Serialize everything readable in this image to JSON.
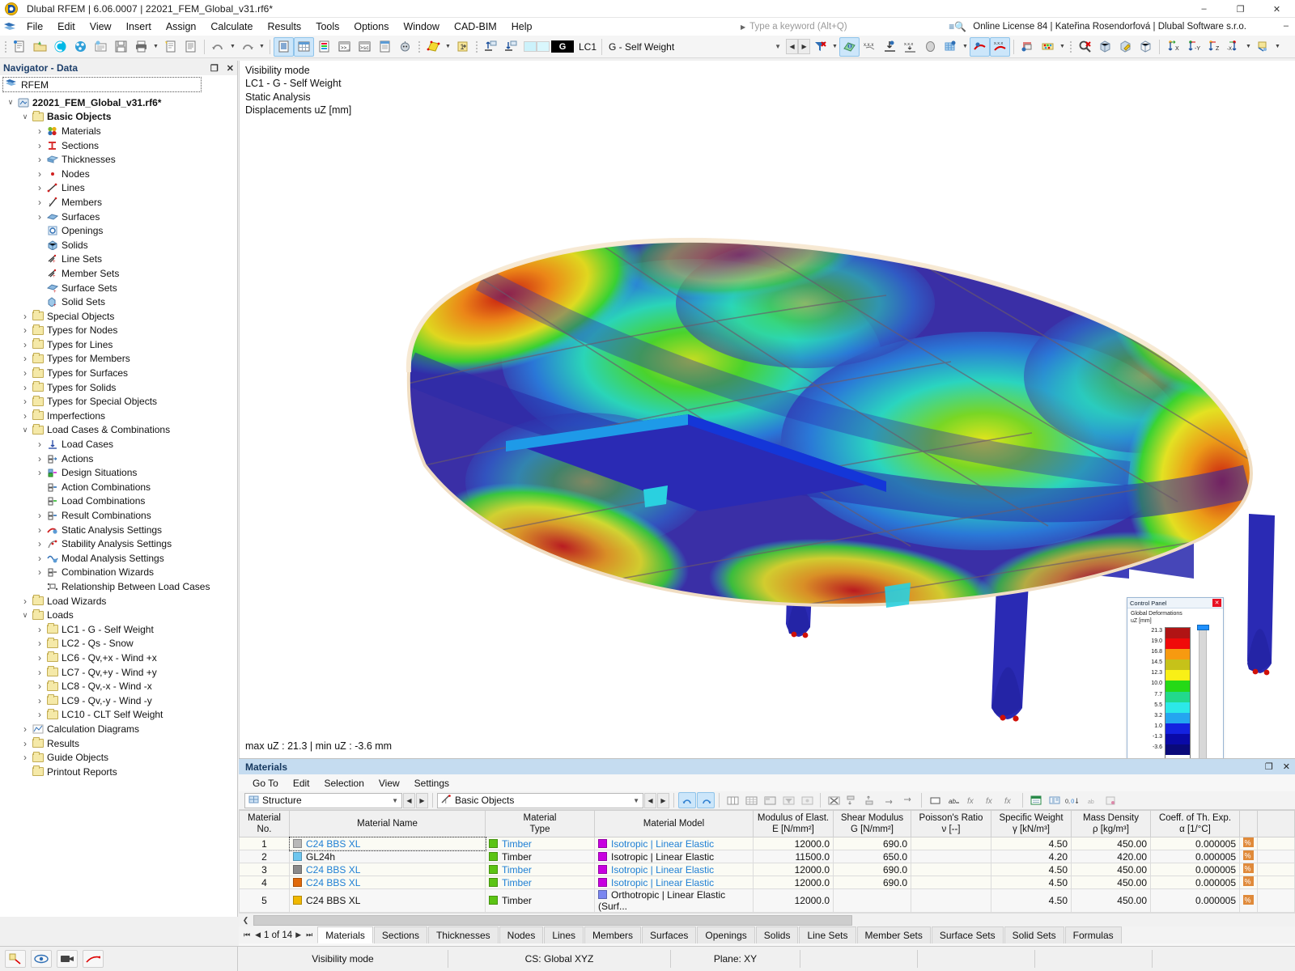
{
  "window": {
    "title": "Dlubal RFEM | 6.06.0007 | 22021_FEM_Global_v31.rf6*",
    "minimize": "–",
    "maximize": "❐",
    "close": "✕"
  },
  "menubar": {
    "items": [
      "File",
      "Edit",
      "View",
      "Insert",
      "Assign",
      "Calculate",
      "Results",
      "Tools",
      "Options",
      "Window",
      "CAD-BIM",
      "Help"
    ],
    "keyword_search_placeholder": "Type a keyword (Alt+Q)",
    "license": "Online License 84 | Kateřina Rosendorfová | Dlubal Software s.r.o.",
    "minimize": "–"
  },
  "toolbar": {
    "load_case_letter": "G",
    "load_case_id": "LC1",
    "load_case_name": "G - Self Weight",
    "icons": [
      "new-model-icon",
      "open-icon",
      "cloud-icon",
      "network-icon",
      "model-info-icon",
      "save-icon",
      "print-icon",
      "print-preview-icon",
      "printout-report-icon",
      "undo-icon",
      "redo-icon",
      "navigator-icon",
      "table-icon",
      "colors-icon",
      "console-icon",
      "script-icon",
      "data-icon",
      "help-robot-icon",
      "render-icon",
      "numbering-icon",
      "surface-result-icon",
      "deformation-icon",
      "filter-icon",
      "results-on-surfaces-icon",
      "values-icon",
      "result-diagram-icon",
      "search-delete-icon",
      "solid-view-icon",
      "edit-view-icon",
      "wireframe-icon",
      "axis-x-icon",
      "axis-y-icon",
      "axis-z-icon",
      "axis-negx-icon",
      "perspective-icon"
    ]
  },
  "navigator": {
    "title": "Navigator - Data",
    "undock": "❐",
    "close": "✕",
    "root_combo": "RFEM",
    "tree": [
      {
        "depth": 0,
        "twist": "open",
        "icon": "model-icon",
        "label": "22021_FEM_Global_v31.rf6*",
        "bold": true
      },
      {
        "depth": 1,
        "twist": "open",
        "icon": "folder",
        "label": "Basic Objects",
        "bold": true
      },
      {
        "depth": 2,
        "twist": "closed",
        "icon": "materials-icon",
        "label": "Materials"
      },
      {
        "depth": 2,
        "twist": "closed",
        "icon": "sections-icon",
        "label": "Sections"
      },
      {
        "depth": 2,
        "twist": "closed",
        "icon": "thicknesses-icon",
        "label": "Thicknesses"
      },
      {
        "depth": 2,
        "twist": "closed",
        "icon": "nodes-icon",
        "label": "Nodes"
      },
      {
        "depth": 2,
        "twist": "closed",
        "icon": "lines-icon",
        "label": "Lines"
      },
      {
        "depth": 2,
        "twist": "closed",
        "icon": "members-icon",
        "label": "Members"
      },
      {
        "depth": 2,
        "twist": "closed",
        "icon": "surfaces-icon",
        "label": "Surfaces"
      },
      {
        "depth": 2,
        "twist": "none",
        "icon": "openings-icon",
        "label": "Openings"
      },
      {
        "depth": 2,
        "twist": "none",
        "icon": "solids-icon",
        "label": "Solids"
      },
      {
        "depth": 2,
        "twist": "none",
        "icon": "line-sets-icon",
        "label": "Line Sets"
      },
      {
        "depth": 2,
        "twist": "none",
        "icon": "member-sets-icon",
        "label": "Member Sets"
      },
      {
        "depth": 2,
        "twist": "none",
        "icon": "surface-sets-icon",
        "label": "Surface Sets"
      },
      {
        "depth": 2,
        "twist": "none",
        "icon": "solid-sets-icon",
        "label": "Solid Sets"
      },
      {
        "depth": 1,
        "twist": "closed",
        "icon": "folder",
        "label": "Special Objects"
      },
      {
        "depth": 1,
        "twist": "closed",
        "icon": "folder",
        "label": "Types for Nodes"
      },
      {
        "depth": 1,
        "twist": "closed",
        "icon": "folder",
        "label": "Types for Lines"
      },
      {
        "depth": 1,
        "twist": "closed",
        "icon": "folder",
        "label": "Types for Members"
      },
      {
        "depth": 1,
        "twist": "closed",
        "icon": "folder",
        "label": "Types for Surfaces"
      },
      {
        "depth": 1,
        "twist": "closed",
        "icon": "folder",
        "label": "Types for Solids"
      },
      {
        "depth": 1,
        "twist": "closed",
        "icon": "folder",
        "label": "Types for Special Objects"
      },
      {
        "depth": 1,
        "twist": "closed",
        "icon": "folder",
        "label": "Imperfections"
      },
      {
        "depth": 1,
        "twist": "open",
        "icon": "folder",
        "label": "Load Cases & Combinations"
      },
      {
        "depth": 2,
        "twist": "closed",
        "icon": "load-cases-icon",
        "label": "Load Cases"
      },
      {
        "depth": 2,
        "twist": "closed",
        "icon": "actions-icon",
        "label": "Actions"
      },
      {
        "depth": 2,
        "twist": "closed",
        "icon": "design-situations-icon",
        "label": "Design Situations"
      },
      {
        "depth": 2,
        "twist": "none",
        "icon": "action-combinations-icon",
        "label": "Action Combinations"
      },
      {
        "depth": 2,
        "twist": "none",
        "icon": "load-combinations-icon",
        "label": "Load Combinations"
      },
      {
        "depth": 2,
        "twist": "closed",
        "icon": "result-combinations-icon",
        "label": "Result Combinations"
      },
      {
        "depth": 2,
        "twist": "closed",
        "icon": "static-analysis-icon",
        "label": "Static Analysis Settings"
      },
      {
        "depth": 2,
        "twist": "closed",
        "icon": "stability-analysis-icon",
        "label": "Stability Analysis Settings"
      },
      {
        "depth": 2,
        "twist": "closed",
        "icon": "modal-analysis-icon",
        "label": "Modal Analysis Settings"
      },
      {
        "depth": 2,
        "twist": "closed",
        "icon": "combination-wizards-icon",
        "label": "Combination Wizards"
      },
      {
        "depth": 2,
        "twist": "none",
        "icon": "relationship-icon",
        "label": "Relationship Between Load Cases"
      },
      {
        "depth": 1,
        "twist": "closed",
        "icon": "folder",
        "label": "Load Wizards"
      },
      {
        "depth": 1,
        "twist": "open",
        "icon": "folder",
        "label": "Loads"
      },
      {
        "depth": 2,
        "twist": "closed",
        "icon": "folder",
        "label": "LC1 - G - Self Weight"
      },
      {
        "depth": 2,
        "twist": "closed",
        "icon": "folder",
        "label": "LC2 - Qs - Snow"
      },
      {
        "depth": 2,
        "twist": "closed",
        "icon": "folder",
        "label": "LC6 - Qv,+x - Wind +x"
      },
      {
        "depth": 2,
        "twist": "closed",
        "icon": "folder",
        "label": "LC7 - Qv,+y - Wind +y"
      },
      {
        "depth": 2,
        "twist": "closed",
        "icon": "folder",
        "label": "LC8 - Qv,-x - Wind -x"
      },
      {
        "depth": 2,
        "twist": "closed",
        "icon": "folder",
        "label": "LC9 - Qv,-y - Wind -y"
      },
      {
        "depth": 2,
        "twist": "closed",
        "icon": "folder",
        "label": "LC10 - CLT Self Weight"
      },
      {
        "depth": 1,
        "twist": "closed",
        "icon": "calculation-diagrams-icon",
        "label": "Calculation Diagrams"
      },
      {
        "depth": 1,
        "twist": "closed",
        "icon": "folder",
        "label": "Results"
      },
      {
        "depth": 1,
        "twist": "closed",
        "icon": "folder",
        "label": "Guide Objects"
      },
      {
        "depth": 1,
        "twist": "none",
        "icon": "folder",
        "label": "Printout Reports"
      }
    ]
  },
  "viewport": {
    "info_lines": [
      "Visibility mode",
      "LC1 - G - Self Weight",
      "Static Analysis",
      "Displacements uZ [mm]"
    ],
    "max_min": "max uZ : 21.3 | min uZ : -3.6 mm"
  },
  "control_panel": {
    "title": "Control Panel",
    "close": "✕",
    "subtitle_line1": "Global Deformations",
    "subtitle_line2": "uZ [mm]",
    "scale_values": [
      "21.3",
      "19.0",
      "16.8",
      "14.5",
      "12.3",
      "10.0",
      "7.7",
      "5.5",
      "3.2",
      "1.0",
      "-1.3",
      "-3.6"
    ],
    "scale_colors": [
      "#b01414",
      "#f00a0a",
      "#f79a10",
      "#c6c219",
      "#f9f016",
      "#25d916",
      "#22d98c",
      "#2ce8e8",
      "#24a5f0",
      "#1422e0",
      "#0a0aa8",
      "#0a0a7a"
    ]
  },
  "chart_data": {
    "type": "heatmap",
    "title": "Global Deformations uZ [mm]",
    "legend_position": "right",
    "colorbar_label": "uZ [mm]",
    "ticks": [
      21.3,
      19.0,
      16.8,
      14.5,
      12.3,
      10.0,
      7.7,
      5.5,
      3.2,
      1.0,
      -1.3,
      -3.6
    ],
    "colors": [
      "#b01414",
      "#f00a0a",
      "#f79a10",
      "#c6c219",
      "#f9f016",
      "#25d916",
      "#22d98c",
      "#2ce8e8",
      "#24a5f0",
      "#1422e0",
      "#0a0aa8",
      "#0a0a7a"
    ],
    "zlim": [
      -3.6,
      21.3
    ],
    "max_value": 21.3,
    "min_value": -3.6,
    "units": "mm",
    "load_case": "LC1 - G - Self Weight",
    "analysis": "Static Analysis"
  },
  "materials_panel": {
    "title": "Materials",
    "undock": "❐",
    "close": "✕",
    "menu": [
      "Go To",
      "Edit",
      "Selection",
      "View",
      "Settings"
    ],
    "filter_left": "Structure",
    "filter_right": "Basic Objects",
    "columns": [
      {
        "line1": "Material",
        "line2": "No."
      },
      {
        "line1": "",
        "line2": "Material Name"
      },
      {
        "line1": "Material",
        "line2": "Type"
      },
      {
        "line1": "",
        "line2": "Material Model"
      },
      {
        "line1": "Modulus of Elast.",
        "line2": "E [N/mm²]"
      },
      {
        "line1": "Shear Modulus",
        "line2": "G [N/mm²]"
      },
      {
        "line1": "Poisson's Ratio",
        "line2": "ν [--]"
      },
      {
        "line1": "Specific Weight",
        "line2": "γ [kN/m³]"
      },
      {
        "line1": "Mass Density",
        "line2": "ρ [kg/m³]"
      },
      {
        "line1": "Coeff. of Th. Exp.",
        "line2": "α [1/°C]"
      }
    ],
    "rows": [
      {
        "no": "1",
        "color": "#b8b8b8",
        "name": "C24 BBS XL",
        "type": "Timber",
        "model": "Isotropic | Linear Elastic",
        "model_color": "#c800e0",
        "E": "12000.0",
        "G": "690.0",
        "nu": "",
        "gamma": "4.50",
        "rho": "450.00",
        "alpha": "0.000005",
        "blue": true,
        "selected": true
      },
      {
        "no": "2",
        "color": "#6ec6ef",
        "name": "GL24h",
        "type": "Timber",
        "model": "Isotropic | Linear Elastic",
        "model_color": "#c800e0",
        "E": "11500.0",
        "G": "650.0",
        "nu": "",
        "gamma": "4.20",
        "rho": "420.00",
        "alpha": "0.000005",
        "blue": false,
        "selected": false
      },
      {
        "no": "3",
        "color": "#8a8a8a",
        "name": "C24 BBS XL",
        "type": "Timber",
        "model": "Isotropic | Linear Elastic",
        "model_color": "#c800e0",
        "E": "12000.0",
        "G": "690.0",
        "nu": "",
        "gamma": "4.50",
        "rho": "450.00",
        "alpha": "0.000005",
        "blue": true,
        "selected": false
      },
      {
        "no": "4",
        "color": "#e06a0a",
        "name": "C24 BBS XL",
        "type": "Timber",
        "model": "Isotropic | Linear Elastic",
        "model_color": "#c800e0",
        "E": "12000.0",
        "G": "690.0",
        "nu": "",
        "gamma": "4.50",
        "rho": "450.00",
        "alpha": "0.000005",
        "blue": true,
        "selected": false
      },
      {
        "no": "5",
        "color": "#f0b800",
        "name": "C24 BBS XL",
        "type": "Timber",
        "model": "Orthotropic | Linear Elastic (Surf...",
        "model_color": "#7a86f0",
        "E": "12000.0",
        "G": "",
        "nu": "",
        "gamma": "4.50",
        "rho": "450.00",
        "alpha": "0.000005",
        "blue": false,
        "selected": false
      }
    ],
    "pager": "1 of 14",
    "tabs": [
      "Materials",
      "Sections",
      "Thicknesses",
      "Nodes",
      "Lines",
      "Members",
      "Surfaces",
      "Openings",
      "Solids",
      "Line Sets",
      "Member Sets",
      "Surface Sets",
      "Solid Sets",
      "Formulas"
    ],
    "active_tab": "Materials"
  },
  "statusbar": {
    "mode": "Visibility mode",
    "cs": "CS: Global XYZ",
    "plane": "Plane: XY",
    "icons": [
      "snap-icon",
      "visibility-icon",
      "camera-icon",
      "pen-icon"
    ]
  }
}
